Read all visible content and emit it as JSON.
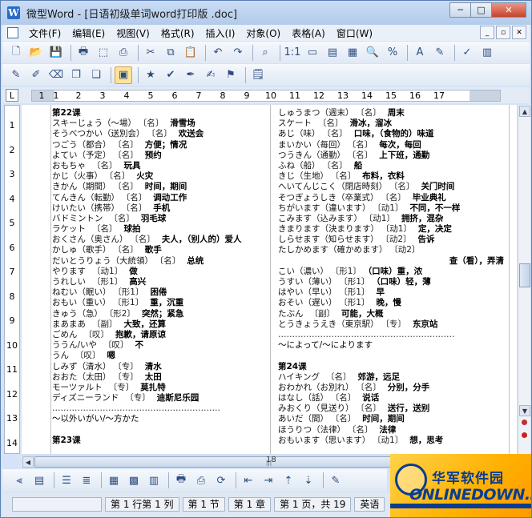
{
  "window": {
    "app_icon": "W",
    "title": "微型Word - [日语初级单词word打印版 .doc]",
    "buttons": {
      "minimize": "─",
      "maximize": "□",
      "close": "✕"
    }
  },
  "menu": {
    "items": [
      "文件(F)",
      "编辑(E)",
      "视图(V)",
      "格式(R)",
      "插入(I)",
      "对象(O)",
      "表格(A)",
      "窗口(W)"
    ],
    "mdi_buttons": [
      "_",
      "▫",
      "✕"
    ]
  },
  "toolbar1": {
    "icons": [
      "new-doc-icon",
      "open-folder-icon",
      "save-icon",
      "print-icon",
      "pdf-icon",
      "print-preview-icon",
      "cut-icon",
      "copy-icon",
      "paste-icon",
      "undo-icon",
      "redo-icon",
      "find-icon",
      "page-view-icon",
      "line-view-icon",
      "outline-view-icon",
      "full-view-icon",
      "zoom-icon",
      "percent-icon",
      "font-icon",
      "edit-icon",
      "spellcheck-icon",
      "chart-icon"
    ],
    "glyphs": [
      "🗋",
      "📂",
      "💾",
      "🖶",
      "⬚",
      "⎙",
      "✂",
      "⧉",
      "📋",
      "↶",
      "↷",
      "⌕",
      "1:1",
      "▭",
      "▤",
      "▦",
      "🔍",
      "%",
      "A",
      "✎",
      "✓",
      "▥"
    ]
  },
  "toolbar2": {
    "icons": [
      "pencil-icon",
      "edit-pen-icon",
      "eraser-icon",
      "copy-page-icon",
      "insert-page-icon",
      "clipboard-active-icon",
      "star-icon",
      "mark-icon",
      "marker-icon",
      "pen-icon",
      "brush-icon",
      "note-icon"
    ],
    "glyphs": [
      "✎",
      "✐",
      "⌫",
      "❐",
      "❏",
      "▣",
      "★",
      "✔",
      "✒",
      "✍",
      "⚑",
      "🗒"
    ]
  },
  "ruler": {
    "corner": "L",
    "numbers": [
      "1",
      "2",
      "1",
      "2",
      "3",
      "4",
      "5",
      "6",
      "7",
      "8",
      "9",
      "10",
      "11",
      "12",
      "13",
      "14",
      "15",
      "16",
      "17"
    ]
  },
  "vruler": {
    "numbers": [
      "1",
      "2",
      "3",
      "4",
      "5",
      "6",
      "7",
      "8",
      "9",
      "10",
      "11",
      "12",
      "13",
      "14"
    ]
  },
  "document": {
    "col1": [
      {
        "t": "head",
        "text": "第22课"
      },
      {
        "t": "entry",
        "w": "スキーじょう（～場）",
        "p": "〔名〕",
        "m": "滑雪场"
      },
      {
        "t": "entry",
        "w": "そうべつかい（送別会）",
        "p": "〔名〕",
        "m": "欢送会"
      },
      {
        "t": "entry",
        "w": "つごう（都合）",
        "p": "〔名〕",
        "m": "方便；情况"
      },
      {
        "t": "entry",
        "w": "よてい（予定）",
        "p": "〔名〕",
        "m": "预约"
      },
      {
        "t": "entry",
        "w": "おもちゃ",
        "p": "〔名〕",
        "m": "玩具"
      },
      {
        "t": "entry",
        "w": "かじ（火事）",
        "p": "〔名〕",
        "m": "火灾"
      },
      {
        "t": "entry",
        "w": "きかん（期間）",
        "p": "〔名〕",
        "m": "时间，期间"
      },
      {
        "t": "entry",
        "w": "てんきん（転勤）",
        "p": "〔名〕",
        "m": "调动工作"
      },
      {
        "t": "entry",
        "w": "けいたい（携帯）",
        "p": "〔名〕",
        "m": "手机"
      },
      {
        "t": "entry",
        "w": "バドミントン",
        "p": "〔名〕",
        "m": "羽毛球"
      },
      {
        "t": "entry",
        "w": "ラケット",
        "p": "〔名〕",
        "m": "球拍"
      },
      {
        "t": "entry",
        "w": "おくさん（奥さん）",
        "p": "〔名〕",
        "m": "夫人，（别人的）爱人"
      },
      {
        "t": "entry",
        "w": "かしゅ（歌手）",
        "p": "〔名〕",
        "m": "歌手"
      },
      {
        "t": "entry",
        "w": "だいとうりょう（大統領）",
        "p": "〔名〕",
        "m": "总统"
      },
      {
        "t": "entry",
        "w": "やります",
        "p": "〔动1〕",
        "m": "做"
      },
      {
        "t": "entry",
        "w": "うれしい",
        "p": "〔形1〕",
        "m": "高兴"
      },
      {
        "t": "entry",
        "w": "ねむい（眠い）",
        "p": "〔形1〕",
        "m": "困倦"
      },
      {
        "t": "entry",
        "w": "おもい（重い）",
        "p": "〔形1〕",
        "m": "重，沉重"
      },
      {
        "t": "entry",
        "w": "きゅう（急）",
        "p": "〔形2〕",
        "m": "突然；紧急"
      },
      {
        "t": "entry",
        "w": "まあまあ",
        "p": "〔副〕",
        "m": "大致，还算"
      },
      {
        "t": "entry",
        "w": "ごめん",
        "p": "〔叹〕",
        "m": "抱歉，请原谅"
      },
      {
        "t": "entry",
        "w": "ううん/いや",
        "p": "〔叹〕",
        "m": "不"
      },
      {
        "t": "entry",
        "w": "うん",
        "p": "〔叹〕",
        "m": "嗯"
      },
      {
        "t": "entry",
        "w": "しみず（清水）",
        "p": "〔专〕",
        "m": "清水"
      },
      {
        "t": "entry",
        "w": "おおた（太田）",
        "p": "〔专〕",
        "m": "太田"
      },
      {
        "t": "entry",
        "w": "モーツァルト",
        "p": "〔专〕",
        "m": "莫扎特"
      },
      {
        "t": "entry",
        "w": "ディズニーランド",
        "p": "〔专〕",
        "m": "迪斯尼乐园"
      },
      {
        "t": "sep",
        "text": "……………………………………………………"
      },
      {
        "t": "plain",
        "text": "～以外いがい/～方かた"
      },
      {
        "t": "blank",
        "text": ""
      },
      {
        "t": "head",
        "text": "第23课"
      }
    ],
    "col2": [
      {
        "t": "entry",
        "w": "しゅうまつ（週末）",
        "p": "〔名〕",
        "m": "周末"
      },
      {
        "t": "entry",
        "w": "スケート",
        "p": "〔名〕",
        "m": "滑冰，溜冰"
      },
      {
        "t": "entry",
        "w": "あじ（味）",
        "p": "〔名〕",
        "m": "口味，（食物的）味道"
      },
      {
        "t": "entry",
        "w": "まいかい（毎回）",
        "p": "〔名〕",
        "m": "每次，每回"
      },
      {
        "t": "entry",
        "w": "つうきん（通勤）",
        "p": "〔名〕",
        "m": "上下班，通勤"
      },
      {
        "t": "entry",
        "w": "ふね（船）",
        "p": "〔名〕",
        "m": "船"
      },
      {
        "t": "entry",
        "w": "きじ（生地）",
        "p": "〔名〕",
        "m": "布料，衣料"
      },
      {
        "t": "entry",
        "w": "へいてんじこく（閉店時刻）",
        "p": "〔名〕",
        "m": "关门时间"
      },
      {
        "t": "entry",
        "w": "そつぎょうしき（卒業式）",
        "p": "〔名〕",
        "m": "毕业典礼"
      },
      {
        "t": "entry",
        "w": "ちがいます（違います）",
        "p": "〔动1〕",
        "m": "不同，不一样"
      },
      {
        "t": "entry",
        "w": "こみます（込みます）",
        "p": "〔动1〕",
        "m": "拥挤，混杂"
      },
      {
        "t": "entry",
        "w": "きまります（決まります）",
        "p": "〔动1〕",
        "m": "定，决定"
      },
      {
        "t": "entry",
        "w": "しらせます（知らせます）",
        "p": "〔动2〕",
        "m": "告诉"
      },
      {
        "t": "entry",
        "w": "たしかめます（確かめます）",
        "p": "〔动2〕",
        "m": ""
      },
      {
        "t": "right",
        "text": "查（看），弄清"
      },
      {
        "t": "entry",
        "w": "こい（濃い）",
        "p": "〔形1〕",
        "m": "（口味）重，浓"
      },
      {
        "t": "entry",
        "w": "うすい（薄い）",
        "p": "〔形1〕",
        "m": "（口味）轻，薄"
      },
      {
        "t": "entry",
        "w": "はやい（早い）",
        "p": "〔形1〕",
        "m": "早"
      },
      {
        "t": "entry",
        "w": "おそい（遅い）",
        "p": "〔形1〕",
        "m": "晚，慢"
      },
      {
        "t": "entry",
        "w": "たぶん",
        "p": "〔副〕",
        "m": "可能，大概"
      },
      {
        "t": "entry",
        "w": "とうきょうえき（東京駅）",
        "p": "〔专〕",
        "m": "东京站"
      },
      {
        "t": "sep",
        "text": "………………………………………………………"
      },
      {
        "t": "plain",
        "text": "～によって/～によります"
      },
      {
        "t": "blank",
        "text": ""
      },
      {
        "t": "head",
        "text": "第24课"
      },
      {
        "t": "entry",
        "w": "ハイキング",
        "p": "〔名〕",
        "m": "郊游，远足"
      },
      {
        "t": "entry",
        "w": "おわかれ（お別れ）",
        "p": "〔名〕",
        "m": "分别，分手"
      },
      {
        "t": "entry",
        "w": "はなし（話）",
        "p": "〔名〕",
        "m": "说话"
      },
      {
        "t": "entry",
        "w": "みおくり（見送り）",
        "p": "〔名〕",
        "m": "送行，送别"
      },
      {
        "t": "entry",
        "w": "あいだ（間）",
        "p": "〔名〕",
        "m": "时间，期间"
      },
      {
        "t": "entry",
        "w": "ほうりつ（法律）",
        "p": "〔名〕",
        "m": "法律"
      },
      {
        "t": "entry",
        "w": "おもいます（思います）",
        "p": "〔动1〕",
        "m": "想，思考"
      }
    ]
  },
  "hscroll": {
    "page_mark": "18"
  },
  "vscroll": {
    "up": "▲",
    "down": "▼",
    "prev_page": "●",
    "next_page": "●",
    "dot_colors": [
      "#c03030",
      "#d02020"
    ]
  },
  "toolbar3": {
    "icons": [
      "split-icon",
      "page-icon",
      "list-icon",
      "list2-icon",
      "doc-red-icon",
      "table-icon",
      "table-insert-icon",
      "print2-icon",
      "preview2-icon",
      "refresh-icon",
      "arrow-left-icon",
      "arrow-right-icon",
      "arrow-up-icon",
      "arrow-down-icon",
      "pen2-icon"
    ],
    "glyphs": [
      "⫷",
      "▤",
      "☰",
      "≣",
      "▦",
      "▩",
      "▥",
      "🖶",
      "⎙",
      "⟳",
      "⇤",
      "⇥",
      "⇡",
      "⇣",
      "✎"
    ]
  },
  "status": {
    "position": "第 1 行第 1 列",
    "section": "第 1 节",
    "chapter": "第 1 章",
    "page": "第 1 页，共 19",
    "language": "英语"
  },
  "logo": {
    "cn": "华军软件园",
    "en": "ONLINEDOWN.NET"
  }
}
